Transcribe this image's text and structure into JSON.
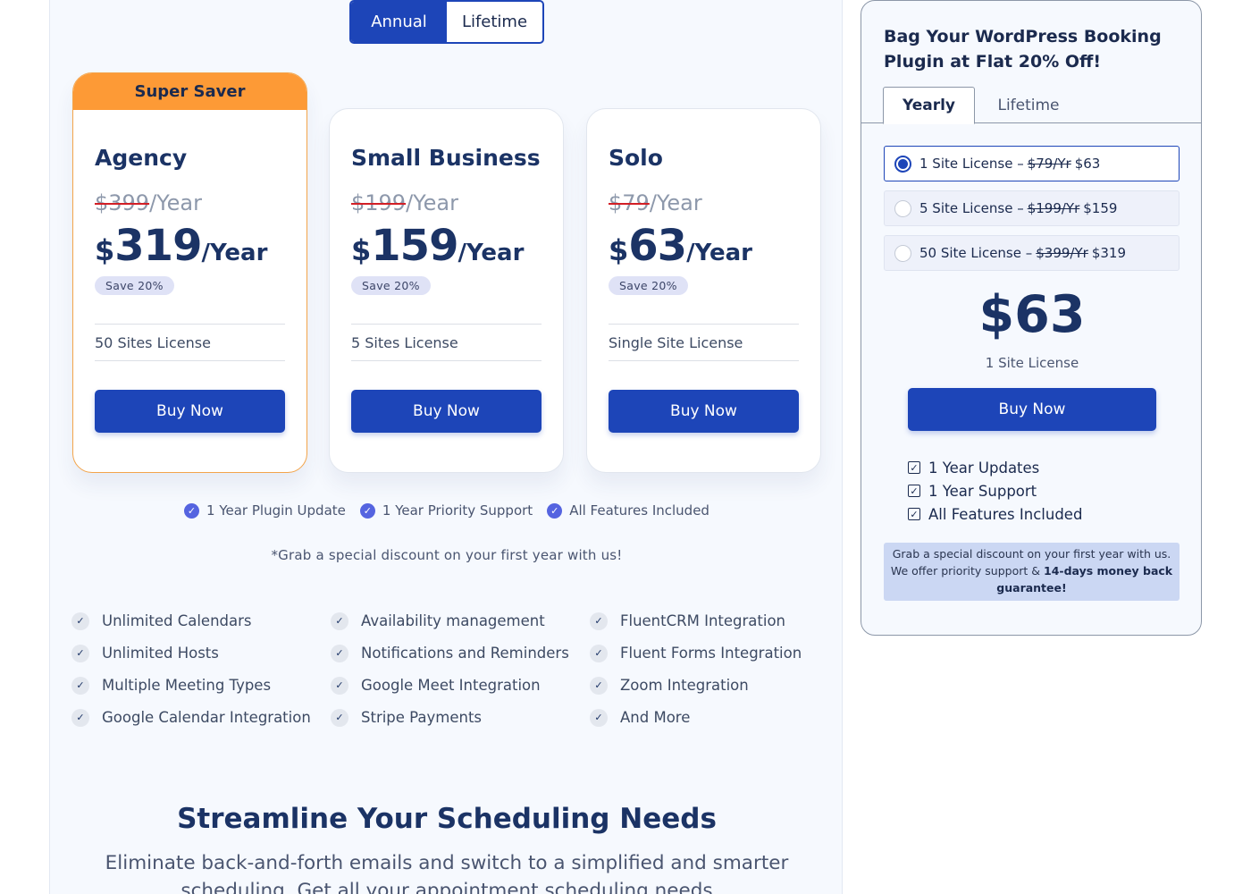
{
  "billing_toggle": {
    "annual": "Annual",
    "lifetime": "Lifetime"
  },
  "plans": [
    {
      "ribbon": "Super Saver",
      "name": "Agency",
      "old_price": "$399",
      "old_suffix": "/Year",
      "currency": "$",
      "price": "319",
      "period": "/Year",
      "badge": "Save 20%",
      "license": "50 Sites License",
      "cta": "Buy Now"
    },
    {
      "name": "Small Business",
      "old_price": "$199",
      "old_suffix": "/Year",
      "currency": "$",
      "price": "159",
      "period": "/Year",
      "badge": "Save 20%",
      "license": "5 Sites License",
      "cta": "Buy Now"
    },
    {
      "name": "Solo",
      "old_price": "$79",
      "old_suffix": "/Year",
      "currency": "$",
      "price": "63",
      "period": "/Year",
      "badge": "Save 20%",
      "license": "Single Site License",
      "cta": "Buy Now"
    }
  ],
  "perks": [
    "1 Year Plugin Update",
    "1 Year Priority Support",
    "All Features Included"
  ],
  "discount_note": "*Grab a special discount on your first year with us!",
  "features": [
    "Unlimited Calendars",
    "Availability management",
    "FluentCRM Integration",
    "Unlimited Hosts",
    "Notifications and Reminders",
    "Fluent Forms Integration",
    "Multiple Meeting Types",
    "Google Meet Integration",
    "Zoom Integration",
    "Google Calendar Integration",
    "Stripe Payments",
    "And More"
  ],
  "section": {
    "title": "Streamline Your Scheduling Needs",
    "text": "Eliminate back-and-forth emails and switch to a simplified and smarter scheduling. Get all your appointment scheduling needs"
  },
  "side": {
    "title": "Bag Your WordPress Booking Plugin at Flat 20% Off!",
    "tabs": {
      "yearly": "Yearly",
      "lifetime": "Lifetime"
    },
    "options": [
      {
        "label": "1 Site License –",
        "old": "$79/Yr",
        "price": "$63"
      },
      {
        "label": "5 Site License –",
        "old": "$199/Yr",
        "price": "$159"
      },
      {
        "label": "50 Site License –",
        "old": "$399/Yr",
        "price": "$319"
      }
    ],
    "price": "$63",
    "license": "1 Site License",
    "cta": "Buy Now",
    "benefits": [
      "1 Year Updates",
      "1 Year Support",
      "All Features Included"
    ],
    "note_line1": "Grab a special discount on your first year with us.",
    "note_line2_prefix": "We offer priority support &",
    "note_bold": "14-days money back guarantee!"
  },
  "colors": {
    "brand": "#1d45b8",
    "ribbon": "#fd9a36",
    "strike": "#d21f26",
    "heading": "#1b3365"
  }
}
